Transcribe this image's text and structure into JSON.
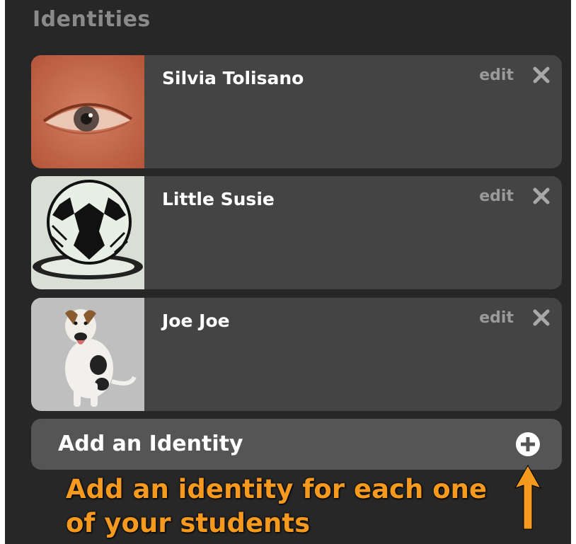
{
  "section": {
    "title": "Identities"
  },
  "identities": [
    {
      "name": "Silvia Tolisano",
      "edit_label": "edit",
      "avatar": "eye-photo"
    },
    {
      "name": "Little Susie",
      "edit_label": "edit",
      "avatar": "soccer-ball-drawing"
    },
    {
      "name": "Joe Joe",
      "edit_label": "edit",
      "avatar": "dog-photo"
    }
  ],
  "add_identity": {
    "label": "Add an Identity",
    "icon": "plus-circle-icon"
  },
  "annotation": {
    "line1": "Add an identity for each one",
    "line2": "of your students",
    "color": "#f59a1e"
  },
  "colors": {
    "panel_bg": "#272727",
    "card_bg": "#444444",
    "add_bg": "#555555",
    "muted_text": "#9a9a9a"
  }
}
